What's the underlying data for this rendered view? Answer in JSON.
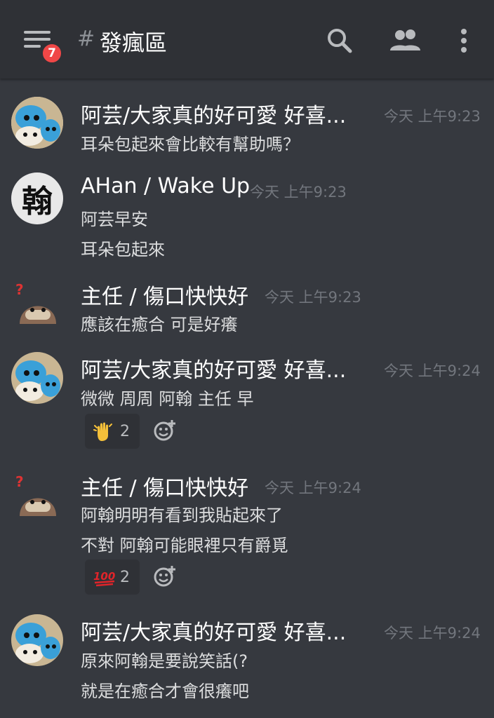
{
  "header": {
    "badge": "7",
    "hash": "#",
    "channel": "發瘋區"
  },
  "messages": [
    {
      "username": "阿芸/大家真的好可愛 好喜...",
      "time": "今天 上午9:23",
      "lines": [
        "耳朵包起來會比較有幫助嗎？"
      ]
    },
    {
      "username": "AHan / Wake Up",
      "time": "今天 上午9:23",
      "avatar_text": "翰",
      "lines": [
        "阿芸早安",
        "耳朵包起來"
      ]
    },
    {
      "username": "主任 / 傷口快快好",
      "time": "今天 上午9:23",
      "lines": [
        "應該在癒合 可是好癢"
      ]
    },
    {
      "username": "阿芸/大家真的好可愛 好喜...",
      "time": "今天 上午9:24",
      "lines": [
        "微微 周周 阿翰 主任 早"
      ],
      "reaction": {
        "emoji": "waving-hands",
        "count": "2"
      }
    },
    {
      "username": "主任 / 傷口快快好",
      "time": "今天 上午9:24",
      "lines": [
        "阿翰明明有看到我貼起來了",
        "不對 阿翰可能眼裡只有爵覓"
      ],
      "reaction": {
        "emoji": "hundred-points",
        "glyph": "100",
        "count": "2"
      }
    },
    {
      "username": "阿芸/大家真的好可愛 好喜...",
      "time": "今天 上午9:24",
      "lines": [
        "原來阿翰是要說笑話(?",
        "就是在癒合才會很癢吧"
      ]
    }
  ],
  "colors": {
    "background": "#36393f",
    "header": "#2f3136",
    "badge": "#f04747",
    "timestamp": "#72767d"
  }
}
